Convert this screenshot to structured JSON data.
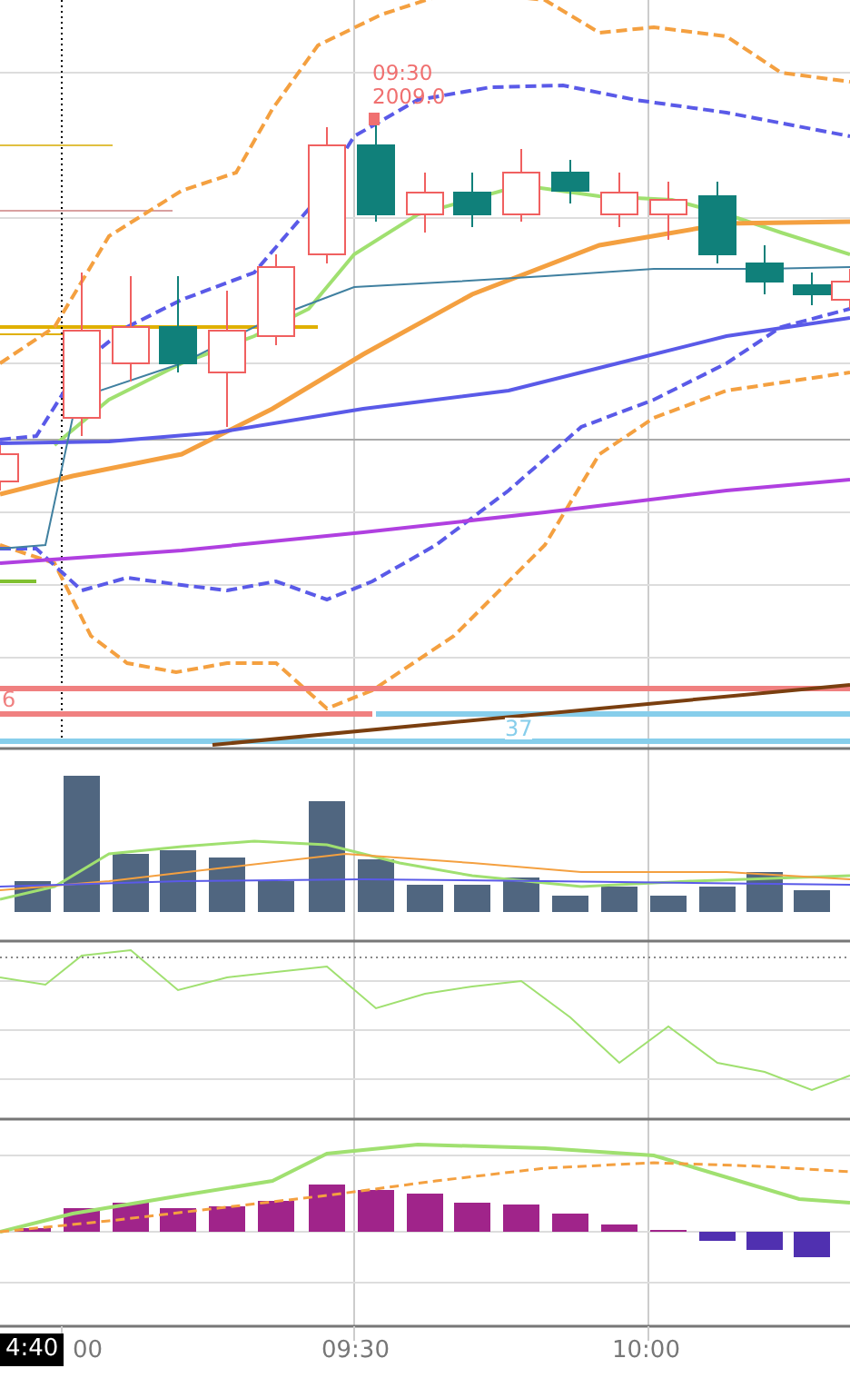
{
  "price_marker": {
    "time": "09:30",
    "price": "2009.0"
  },
  "level_labels": [
    {
      "text": "6",
      "color": "#f08080"
    },
    {
      "text": "37",
      "color": "#87ceeb"
    }
  ],
  "x_axis": {
    "cursor_label": "4:40",
    "labels": [
      "00",
      "09:30",
      "10:00"
    ]
  }
}
